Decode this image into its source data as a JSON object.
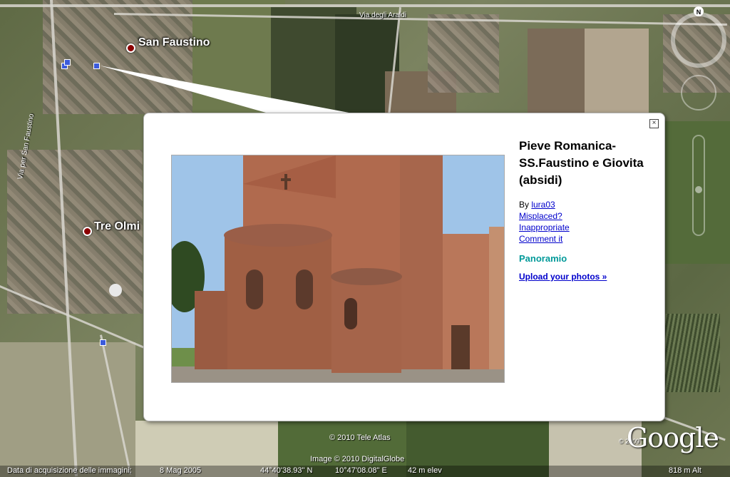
{
  "map": {
    "place_labels": [
      "San Faustino",
      "Tre Olmi"
    ],
    "street_labels": [
      "Via degli Araldi",
      "Via per San Faustino"
    ]
  },
  "balloon": {
    "title": "Pieve Romanica-SS.Faustino e Giovita (absidi)",
    "by_prefix": "By ",
    "author": "lura03",
    "links": [
      "Misplaced?",
      "Inappropriate",
      "Comment it"
    ],
    "brand": "Panoramio",
    "upload_label": "Upload your photos »",
    "close_label": "×"
  },
  "attribution": {
    "tele_atlas": "© 2010 Tele Atlas",
    "imagery": "Image © 2010 DigitalGlobe",
    "copyright_small": "© 2009",
    "logo": "Google"
  },
  "status": {
    "date_label": "Data di acquisizione delle immagini:",
    "date_value": "8 Mag 2005",
    "lat": "44°40'38.93\" N",
    "lon": "10°47'08.08\" E",
    "elev": "42 m  elev",
    "alt": "818 m  Alt"
  },
  "nav": {
    "north_label": "N"
  }
}
